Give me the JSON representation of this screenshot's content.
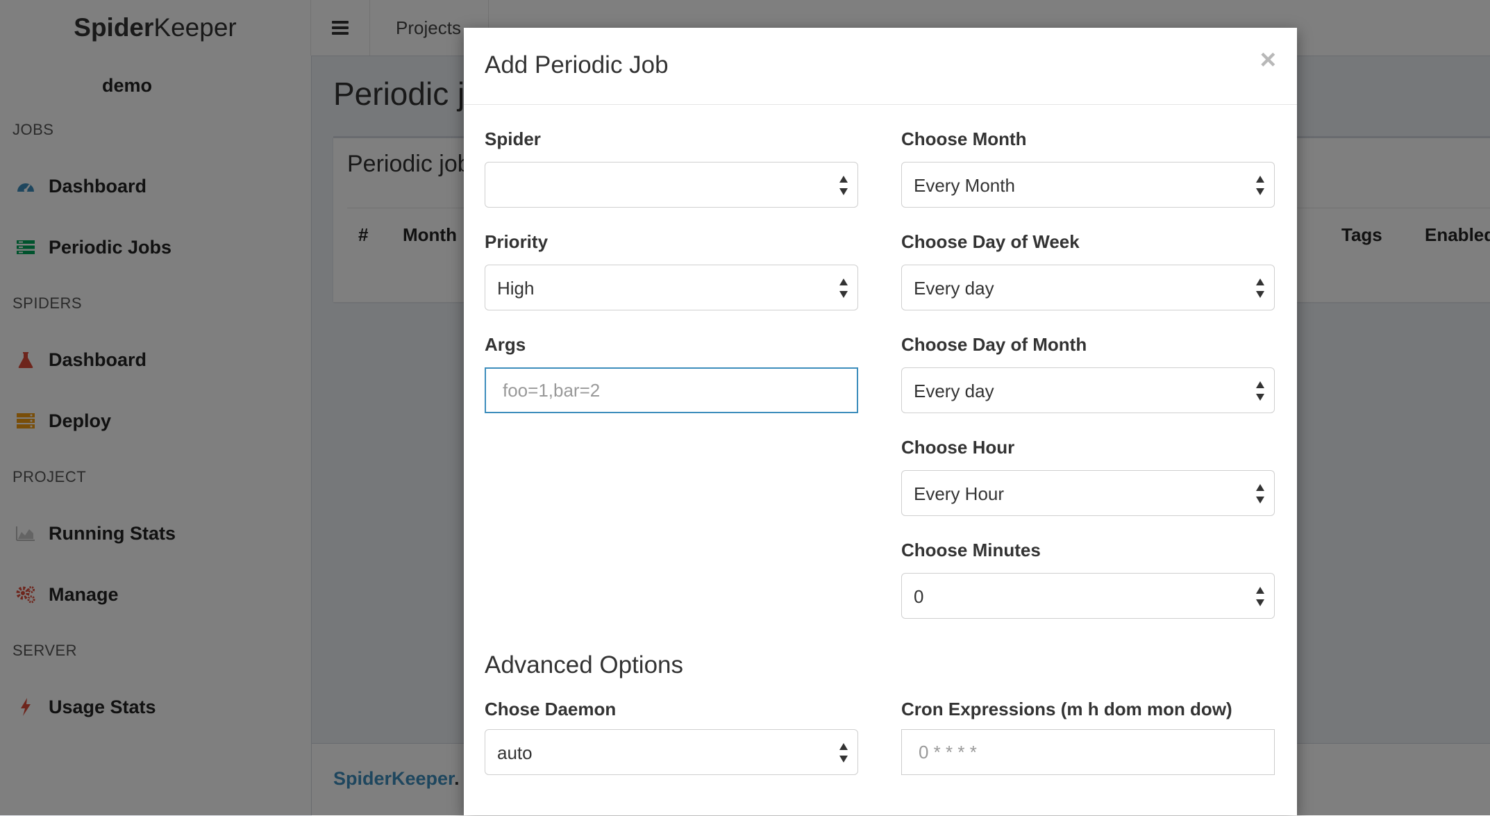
{
  "header": {
    "logo_bold": "Spider",
    "logo_light": "Keeper",
    "nav_projects": "Projects"
  },
  "sidebar": {
    "user": "demo",
    "sections": {
      "jobs": "JOBS",
      "spiders": "SPIDERS",
      "project": "PROJECT",
      "server": "SERVER"
    },
    "items": [
      {
        "label": "Dashboard",
        "icon": "dashboard-icon",
        "color": "#3c8dbc"
      },
      {
        "label": "Periodic Jobs",
        "icon": "list-icon",
        "color": "#00a65a"
      },
      {
        "label": "Dashboard",
        "icon": "flask-icon",
        "color": "#dd4b39"
      },
      {
        "label": "Deploy",
        "icon": "server-icon",
        "color": "#f39c12"
      },
      {
        "label": "Running Stats",
        "icon": "area-chart-icon",
        "color": "#c0c0c0"
      },
      {
        "label": "Manage",
        "icon": "gears-icon",
        "color": "#dd4b39"
      },
      {
        "label": "Usage Stats",
        "icon": "bolt-icon",
        "color": "#dd4b39"
      }
    ]
  },
  "content": {
    "page_title": "Periodic j",
    "box_title": "Periodic job",
    "columns": [
      "#",
      "Month",
      "Tags",
      "Enabled"
    ]
  },
  "footer": {
    "brand": "SpiderKeeper",
    "suffix": "."
  },
  "modal": {
    "title": "Add Periodic Job",
    "close": "×",
    "spider": {
      "label": "Spider",
      "value": ""
    },
    "priority": {
      "label": "Priority",
      "value": "High"
    },
    "args": {
      "label": "Args",
      "placeholder": "foo=1,bar=2"
    },
    "month": {
      "label": "Choose Month",
      "value": "Every Month"
    },
    "day_of_week": {
      "label": "Choose Day of Week",
      "value": "Every day"
    },
    "day_of_month": {
      "label": "Choose Day of Month",
      "value": "Every day"
    },
    "hour": {
      "label": "Choose Hour",
      "value": "Every Hour"
    },
    "minutes": {
      "label": "Choose Minutes",
      "value": "0"
    },
    "advanced_title": "Advanced Options",
    "daemon": {
      "label": "Chose Daemon",
      "value": "auto"
    },
    "cron": {
      "label": "Cron Expressions (m h dom mon dow)",
      "placeholder": "0 * * * *"
    }
  },
  "colors": {
    "accent": "#3c8dbc",
    "overlay": "rgba(0,0,0,0.5)"
  }
}
